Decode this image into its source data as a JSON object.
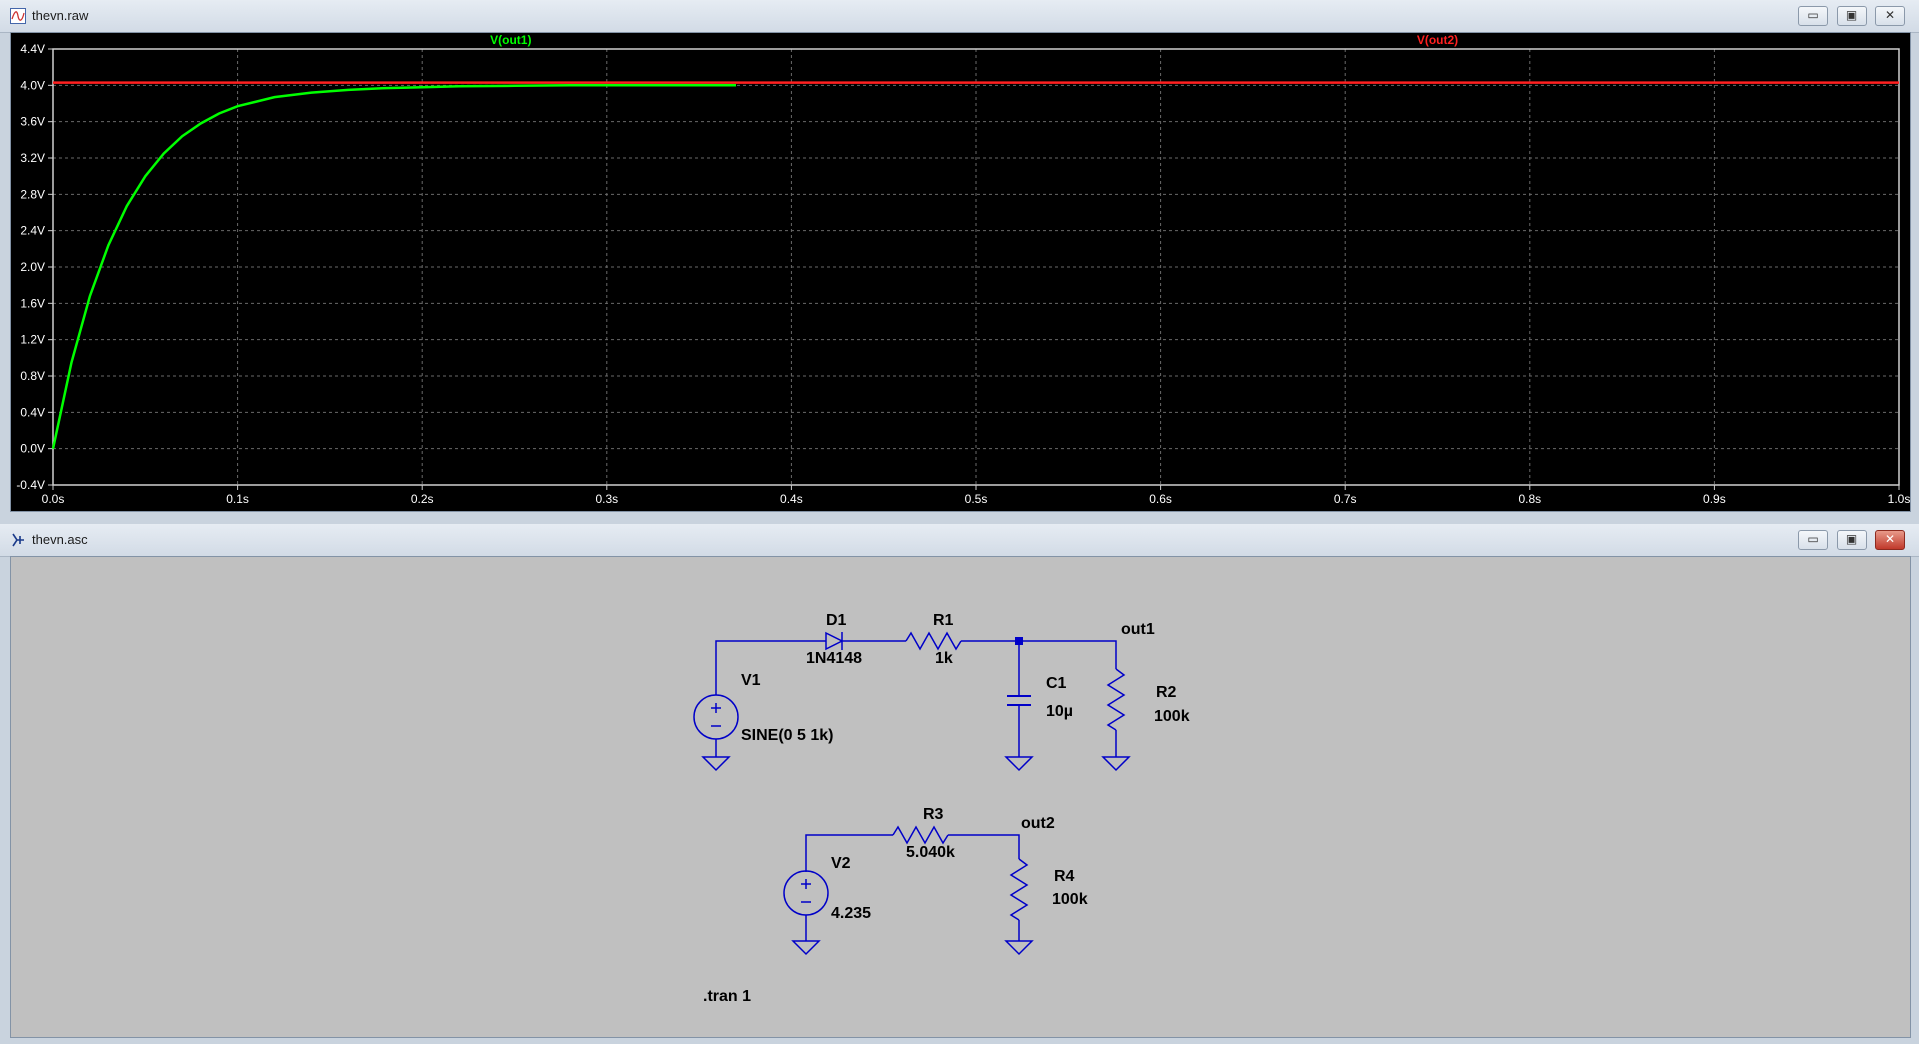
{
  "plot_window": {
    "title": "thevn.raw",
    "icon": "waveform-icon",
    "controls": {
      "minimize": "▭",
      "restore": "▣",
      "close": "✕"
    }
  },
  "schematic_window": {
    "title": "thevn.asc",
    "icon": "schematic-icon",
    "controls": {
      "minimize": "▭",
      "restore": "▣",
      "close": "✕"
    }
  },
  "chart_data": {
    "type": "line",
    "title": "",
    "xlabel": "",
    "ylabel": "",
    "xlim": [
      0,
      1.0
    ],
    "ylim": [
      -0.4,
      4.4
    ],
    "grid": true,
    "background": "#000000",
    "x_ticks": [
      0,
      0.1,
      0.2,
      0.3,
      0.4,
      0.5,
      0.6,
      0.7,
      0.8,
      0.9,
      1.0
    ],
    "x_tick_labels": [
      "0.0s",
      "0.1s",
      "0.2s",
      "0.3s",
      "0.4s",
      "0.5s",
      "0.6s",
      "0.7s",
      "0.8s",
      "0.9s",
      "1.0s"
    ],
    "y_ticks": [
      4.4,
      4.0,
      3.6,
      3.2,
      2.8,
      2.4,
      2.0,
      1.6,
      1.2,
      0.8,
      0.4,
      0.0,
      -0.4
    ],
    "y_tick_labels": [
      "4.4V",
      "4.0V",
      "3.6V",
      "3.2V",
      "2.8V",
      "2.4V",
      "2.0V",
      "1.6V",
      "1.2V",
      "0.8V",
      "0.4V",
      "0.0V",
      "-0.4V"
    ],
    "series": [
      {
        "name": "V(out1)",
        "color": "#00ff00",
        "x": [
          0,
          0.01,
          0.02,
          0.03,
          0.04,
          0.05,
          0.06,
          0.07,
          0.08,
          0.09,
          0.1,
          0.12,
          0.14,
          0.16,
          0.18,
          0.2,
          0.22,
          0.25,
          0.28,
          0.31,
          0.34,
          0.37
        ],
        "values": [
          0.0,
          0.95,
          1.68,
          2.24,
          2.67,
          3.0,
          3.25,
          3.44,
          3.58,
          3.69,
          3.77,
          3.87,
          3.92,
          3.95,
          3.97,
          3.98,
          3.99,
          3.995,
          4.0,
          4.0,
          4.0,
          4.0
        ]
      },
      {
        "name": "V(out2)",
        "color": "#ff2020",
        "x": [
          0,
          1.0
        ],
        "values": [
          4.03,
          4.03
        ]
      }
    ]
  },
  "schematic": {
    "components": {
      "D1": {
        "name": "D1",
        "value": "1N4148"
      },
      "R1": {
        "name": "R1",
        "value": "1k"
      },
      "C1": {
        "name": "C1",
        "value": "10µ"
      },
      "R2": {
        "name": "R2",
        "value": "100k"
      },
      "V1": {
        "name": "V1",
        "value": "SINE(0 5 1k)"
      },
      "R3": {
        "name": "R3",
        "value": "5.040k"
      },
      "R4": {
        "name": "R4",
        "value": "100k"
      },
      "V2": {
        "name": "V2",
        "value": "4.235"
      }
    },
    "nets": {
      "out1": "out1",
      "out2": "out2"
    },
    "directive": ".tran 1",
    "wire_color": "#0000c8"
  }
}
